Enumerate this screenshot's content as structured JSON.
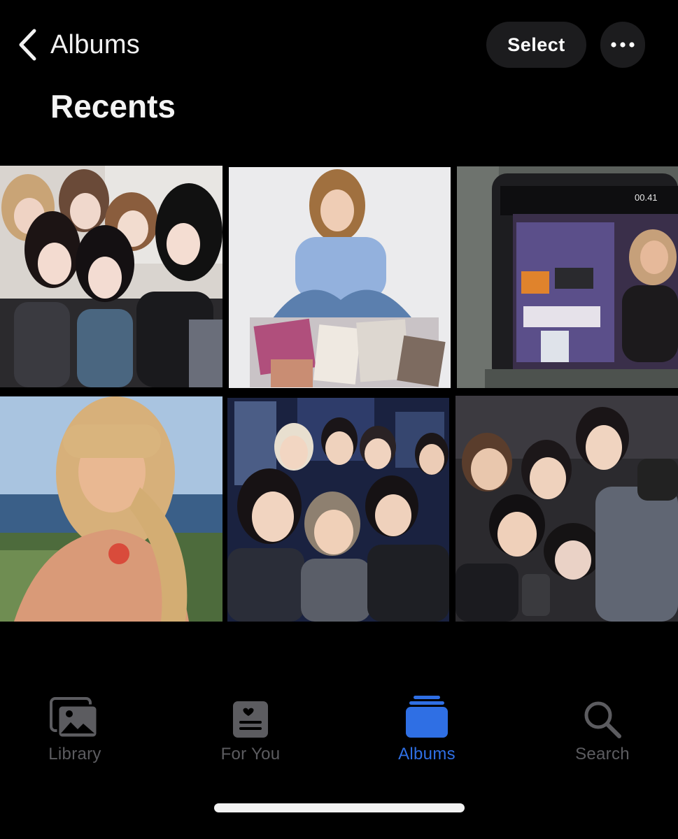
{
  "header": {
    "back_label": "Albums",
    "select_label": "Select",
    "more_icon": "ellipsis-icon"
  },
  "page_title": "Recents",
  "overlay": {
    "video_timer": "00.41"
  },
  "photos": [
    {
      "name": "photo-girl-group",
      "subject": "group-of-five-women"
    },
    {
      "name": "photo-woman-sitting",
      "subject": "woman-in-denim-with-magazines"
    },
    {
      "name": "photo-video-screen",
      "subject": "tablet-showing-video"
    },
    {
      "name": "photo-blonde-woman",
      "subject": "blonde-woman-by-sea"
    },
    {
      "name": "photo-boy-group-stage",
      "subject": "group-of-young-men-on-stage"
    },
    {
      "name": "photo-boy-group-dark",
      "subject": "group-of-young-men-dark-background"
    }
  ],
  "tabs": [
    {
      "label": "Library",
      "icon": "photo-library-icon",
      "active": false
    },
    {
      "label": "For You",
      "icon": "for-you-icon",
      "active": false
    },
    {
      "label": "Albums",
      "icon": "albums-icon",
      "active": true
    },
    {
      "label": "Search",
      "icon": "search-icon",
      "active": false
    }
  ],
  "colors": {
    "background": "#000000",
    "accent": "#2f6fe4",
    "inactive_tab": "#5c5c60",
    "button_bg": "#1c1c1e"
  }
}
